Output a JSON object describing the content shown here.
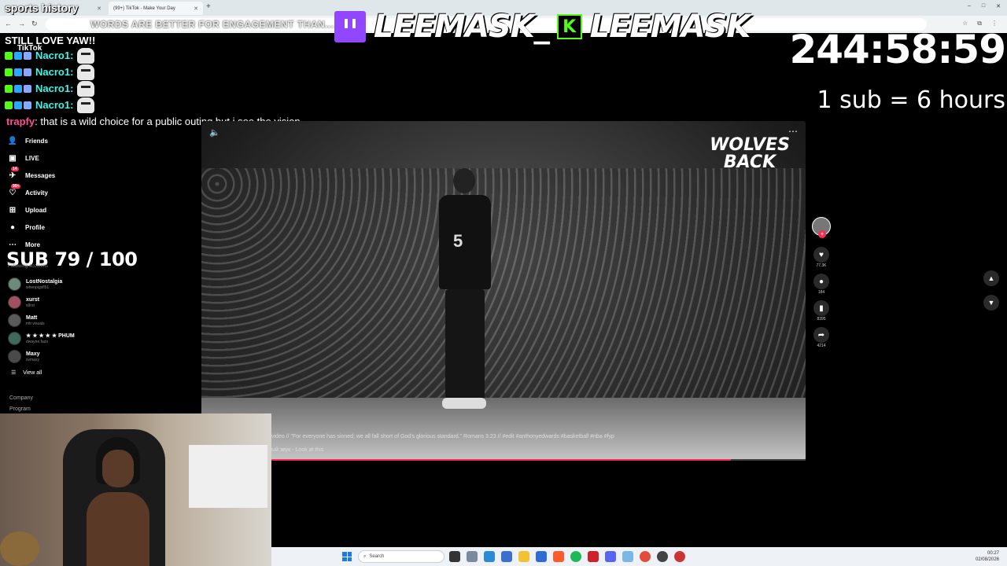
{
  "browser": {
    "tabs": [
      {
        "label": "Sports history"
      },
      {
        "label": "(99+) TikTok - Make Your Day"
      }
    ],
    "new_tab": "+",
    "window_controls": [
      "–",
      "□",
      "✕"
    ]
  },
  "overlay": {
    "title": "sports history",
    "marquee": "WORDS ARE BETTER FOR ENGAGEMENT THAN...",
    "banner_twitch_name": "LEEMASK_",
    "banner_kick_letter": "K",
    "banner_kick_name": "LEEMASK",
    "timer": "244:58:59",
    "sub_rate": "1 sub = 6 hours",
    "sub_goal": "SUB 79 / 100"
  },
  "chat": {
    "first": "STILL LOVE YAW!!",
    "lines": [
      {
        "user": "Nacro1:"
      },
      {
        "user": "Nacro1:"
      },
      {
        "user": "Nacro1:"
      },
      {
        "user": "Nacro1:"
      }
    ],
    "last_user": "trapfy",
    "last_message": ": that is a wild choice for a public outing but i see the vision"
  },
  "tiktok": {
    "logo": "TikTok",
    "nav": [
      {
        "label": "Friends",
        "icon": "friends-icon"
      },
      {
        "label": "LIVE",
        "icon": "live-icon"
      },
      {
        "label": "Messages",
        "icon": "messages-icon",
        "badge": "14"
      },
      {
        "label": "Activity",
        "icon": "activity-icon",
        "badge": "99+"
      },
      {
        "label": "Upload",
        "icon": "upload-icon"
      },
      {
        "label": "Profile",
        "icon": "profile-icon"
      },
      {
        "label": "More",
        "icon": "more-icon"
      }
    ],
    "following_header": "Following accounts",
    "following": [
      {
        "name": "LostNostalgia",
        "handle": "whenpigsfl51"
      },
      {
        "name": "xurst",
        "handle": "x9rst"
      },
      {
        "name": "Matt",
        "handle": "mtr.visuals"
      },
      {
        "name": "★ ★ ★ ★ ★ PHUM",
        "handle": "dwayne.fazo"
      },
      {
        "name": "Maxy",
        "handle": "svmaxy"
      }
    ],
    "view_all": "View all",
    "footer": [
      "Company",
      "Program"
    ]
  },
  "video": {
    "watermark_line1": "WOLVES",
    "watermark_line2": "BACK",
    "jersey_number": "5",
    "caption": "video // \"For everyone has sinned; we all fall short of God's glorious standard.\" Romans 3:23 // #edit #anthonyedwards #basketball #nba #fyp",
    "music": "ый звук - Look at this",
    "progress": 0.86
  },
  "actions": {
    "likes": "77.3K",
    "comments": "184",
    "saves": "8395",
    "shares": "4214"
  },
  "taskbar": {
    "search_placeholder": "Search",
    "time": "00:27",
    "date": "02/08/2026"
  },
  "colors": {
    "tiktok_red": "#fe2c55",
    "twitch_purple": "#9146ff",
    "kick_green": "#53fc18",
    "chat_user": "#3ff5e6"
  }
}
